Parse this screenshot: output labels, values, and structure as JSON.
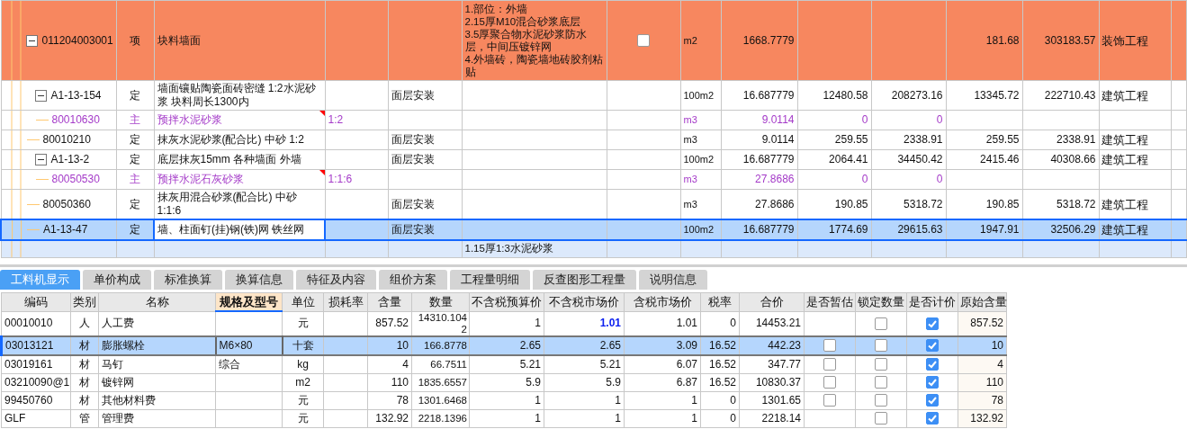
{
  "budget_grid": {
    "rows": [
      {
        "code": "011204003001",
        "type": "项",
        "kind": "item",
        "expanded": true,
        "selected": false,
        "name": "块料墙面",
        "features": "1.部位：外墙\n2.15厚M10混合砂浆底层\n3.5厚聚合物水泥砂浆防水层，中间压镀锌网\n4.外墙砖，陶瓷墙地砖胶剂粘贴",
        "checked": false,
        "unit": "m2",
        "quantity": "1668.7779",
        "column_12": "181.68",
        "column_13": "303183.57",
        "category": "装饰工程",
        "children": [
          {
            "code": "A1-13-154",
            "type": "定",
            "kind": "quota",
            "expanded": true,
            "selected": false,
            "name": "墙面镶贴陶瓷面砖密缝 1:2水泥砂浆 块料周长1300内",
            "work": "面层安装",
            "unit": "100m2",
            "quantity": "16.687779",
            "column_10": "12480.58",
            "column_11": "208273.16",
            "column_12": "13345.72",
            "column_13": "222710.43",
            "category": "建筑工程",
            "children": [
              {
                "code": "80010630",
                "type": "主",
                "kind": "main",
                "selected": false,
                "name": "预拌水泥砂浆",
                "ratio": "1:2",
                "unit": "m3",
                "quantity": "9.0114",
                "column_10": "0",
                "column_11": "0"
              }
            ]
          },
          {
            "code": "80010210",
            "type": "定",
            "kind": "quota",
            "selected": false,
            "name": "抹灰水泥砂浆(配合比) 中砂 1:2",
            "work": "面层安装",
            "unit": "m3",
            "quantity": "9.0114",
            "column_10": "259.55",
            "column_11": "2338.91",
            "column_12": "259.55",
            "column_13": "2338.91",
            "category": "建筑工程"
          },
          {
            "code": "A1-13-2",
            "type": "定",
            "kind": "quota",
            "expanded": true,
            "selected": false,
            "name": "底层抹灰15mm 各种墙面 外墙",
            "work": "面层安装",
            "unit": "100m2",
            "quantity": "16.687779",
            "column_10": "2064.41",
            "column_11": "34450.42",
            "column_12": "2415.46",
            "column_13": "40308.66",
            "category": "建筑工程",
            "children": [
              {
                "code": "80050530",
                "type": "主",
                "kind": "main",
                "selected": false,
                "name": "预拌水泥石灰砂浆",
                "ratio": "1:1:6",
                "unit": "m3",
                "quantity": "27.8686",
                "column_10": "0",
                "column_11": "0"
              }
            ]
          },
          {
            "code": "80050360",
            "type": "定",
            "kind": "quota",
            "selected": false,
            "name": "抹灰用混合砂浆(配合比) 中砂 1:1:6",
            "work": "面层安装",
            "unit": "m3",
            "quantity": "27.8686",
            "column_10": "190.85",
            "column_11": "5318.72",
            "column_12": "190.85",
            "column_13": "5318.72",
            "category": "建筑工程"
          },
          {
            "code": "A1-13-47",
            "type": "定",
            "kind": "quota",
            "selected": true,
            "name": "墙、柱面钉(挂)钢(铁)网 铁丝网",
            "work": "面层安装",
            "unit": "100m2",
            "quantity": "16.687779",
            "column_10": "1774.69",
            "column_11": "29615.63",
            "column_12": "1947.91",
            "column_13": "32506.29",
            "category": "建筑工程"
          }
        ]
      }
    ],
    "partial_row": {
      "features": "1.15厚1:3水泥砂浆"
    }
  },
  "tabs": [
    {
      "label": "工料机显示",
      "selected": true
    },
    {
      "label": "单价构成",
      "selected": false
    },
    {
      "label": "标准换算",
      "selected": false
    },
    {
      "label": "换算信息",
      "selected": false
    },
    {
      "label": "特征及内容",
      "selected": false
    },
    {
      "label": "组价方案",
      "selected": false
    },
    {
      "label": "工程量明细",
      "selected": false
    },
    {
      "label": "反查图形工程量",
      "selected": false
    },
    {
      "label": "说明信息",
      "selected": false
    }
  ],
  "resource_table": {
    "columns": [
      {
        "label": "编码",
        "selected": false
      },
      {
        "label": "类别",
        "selected": false
      },
      {
        "label": "名称",
        "selected": false
      },
      {
        "label": "规格及型号",
        "selected": true
      },
      {
        "label": "单位",
        "selected": false
      },
      {
        "label": "损耗率",
        "selected": false
      },
      {
        "label": "含量",
        "selected": false
      },
      {
        "label": "数量",
        "selected": false
      },
      {
        "label": "不含税预算价",
        "selected": false
      },
      {
        "label": "不含税市场价",
        "selected": false
      },
      {
        "label": "含税市场价",
        "selected": false
      },
      {
        "label": "税率",
        "selected": false
      },
      {
        "label": "合价",
        "selected": false
      },
      {
        "label": "是否暂估",
        "selected": false
      },
      {
        "label": "锁定数量",
        "selected": false
      },
      {
        "label": "是否计价",
        "selected": false
      },
      {
        "label": "原始含量",
        "selected": false
      }
    ],
    "rows": [
      {
        "code": "00010010",
        "category": "人",
        "name": "人工费",
        "unit": "元",
        "content": "857.52",
        "quantity": "14310.1042",
        "budget_price": "1",
        "market_price": "1.01",
        "market_price_modified": true,
        "tax_price": "1.01",
        "tax_rate": "0",
        "total": "14453.21",
        "locked": false,
        "priced": true,
        "original_content": "857.52",
        "selected": false
      },
      {
        "code": "03013121",
        "category": "材",
        "name": "膨胀螺栓",
        "spec": "M6×80",
        "unit": "十套",
        "content": "10",
        "quantity": "166.8778",
        "budget_price": "2.65",
        "market_price": "2.65",
        "market_price_modified": false,
        "tax_price": "3.09",
        "tax_rate": "16.52",
        "total": "442.23",
        "estimate": false,
        "locked": false,
        "priced": true,
        "original_content": "10",
        "selected": true
      },
      {
        "code": "03019161",
        "category": "材",
        "name": "马钉",
        "spec": "综合",
        "unit": "kg",
        "content": "4",
        "quantity": "66.7511",
        "budget_price": "5.21",
        "market_price": "5.21",
        "market_price_modified": false,
        "tax_price": "6.07",
        "tax_rate": "16.52",
        "total": "347.77",
        "estimate": false,
        "locked": false,
        "priced": true,
        "original_content": "4",
        "selected": false
      },
      {
        "code": "03210090@1",
        "category": "材",
        "name": "镀锌网",
        "unit": "m2",
        "content": "110",
        "quantity": "1835.6557",
        "budget_price": "5.9",
        "market_price": "5.9",
        "market_price_modified": false,
        "tax_price": "6.87",
        "tax_rate": "16.52",
        "total": "10830.37",
        "estimate": false,
        "locked": false,
        "priced": true,
        "original_content": "110",
        "selected": false
      },
      {
        "code": "99450760",
        "category": "材",
        "name": "其他材料费",
        "unit": "元",
        "content": "78",
        "quantity": "1301.6468",
        "budget_price": "1",
        "market_price": "1",
        "market_price_modified": false,
        "tax_price": "1",
        "tax_rate": "0",
        "total": "1301.65",
        "estimate": false,
        "locked": false,
        "priced": true,
        "original_content": "78",
        "selected": false
      },
      {
        "code": "GLF",
        "category": "管",
        "name": "管理费",
        "unit": "元",
        "content": "132.92",
        "quantity": "2218.1396",
        "budget_price": "1",
        "market_price": "1",
        "market_price_modified": false,
        "tax_price": "1",
        "tax_rate": "0",
        "total": "2218.14",
        "locked": false,
        "priced": true,
        "original_content": "132.92",
        "selected": false
      }
    ]
  }
}
